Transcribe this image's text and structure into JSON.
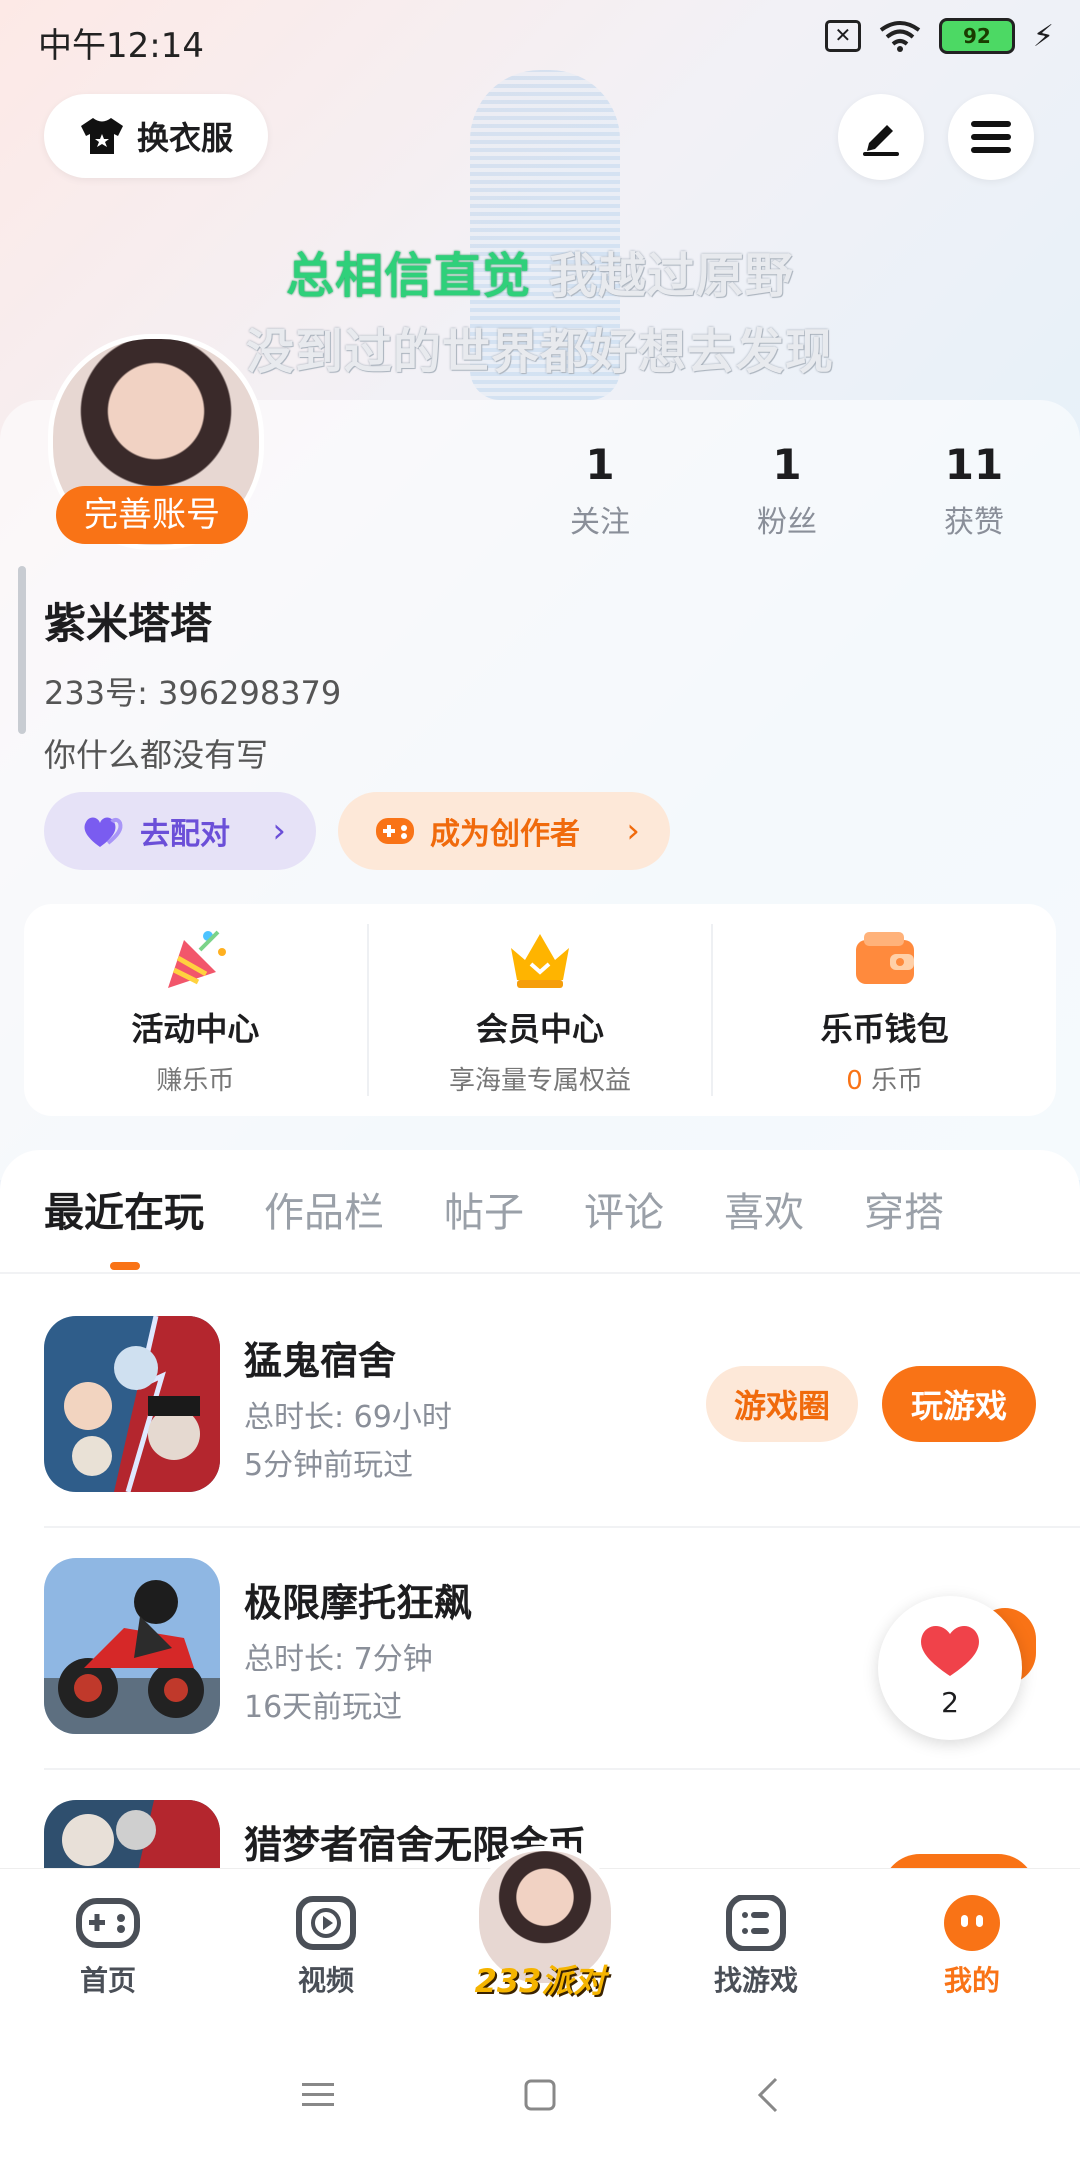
{
  "status_bar": {
    "time": "中午12:14",
    "battery": "92",
    "sim_icon": "sim-off-icon",
    "wifi_icon": "wifi-icon",
    "charging_icon": "charging-icon"
  },
  "header": {
    "wardrobe_label": "换衣服",
    "edit_icon": "edit-icon",
    "menu_icon": "menu-icon"
  },
  "lyrics": {
    "line1_highlight": "总相信直觉",
    "line1_rest": " 我越过原野",
    "line2": "没到过的世界都好想去发现"
  },
  "profile": {
    "complete_account_label": "完善账号",
    "stats": [
      {
        "value": "1",
        "label": "关注"
      },
      {
        "value": "1",
        "label": "粉丝"
      },
      {
        "value": "11",
        "label": "获赞"
      }
    ],
    "name": "紫米塔塔",
    "uid": "233号: 396298379",
    "bio": "你什么都没有写",
    "match_button": "去配对",
    "creator_button": "成为创作者"
  },
  "services": [
    {
      "title": "活动中心",
      "subtitle": "赚乐币",
      "icon": "party-popper-icon"
    },
    {
      "title": "会员中心",
      "subtitle": "享海量专属权益",
      "icon": "crown-icon"
    },
    {
      "title": "乐币钱包",
      "subtitle_value": "0",
      "subtitle_unit": " 乐币",
      "icon": "wallet-icon"
    }
  ],
  "tabs": [
    "最近在玩",
    "作品栏",
    "帖子",
    "评论",
    "喜欢",
    "穿搭"
  ],
  "games": [
    {
      "title": "猛鬼宿舍",
      "duration": "总时长: 69小时",
      "last_played": "5分钟前玩过",
      "circle_button": "游戏圈",
      "play_button": "玩游戏"
    },
    {
      "title": "极限摩托狂飙",
      "duration": "总时长: 7分钟",
      "last_played": "16天前玩过"
    },
    {
      "title": "猎梦者宿舍无限金币"
    }
  ],
  "like_bubble": {
    "count": "2"
  },
  "bottom_nav": [
    {
      "label": "首页"
    },
    {
      "label": "视频"
    },
    {
      "label": "233派对"
    },
    {
      "label": "找游戏"
    },
    {
      "label": "我的"
    }
  ],
  "colors": {
    "accent": "#f97316",
    "match": "#6b4fd8"
  }
}
